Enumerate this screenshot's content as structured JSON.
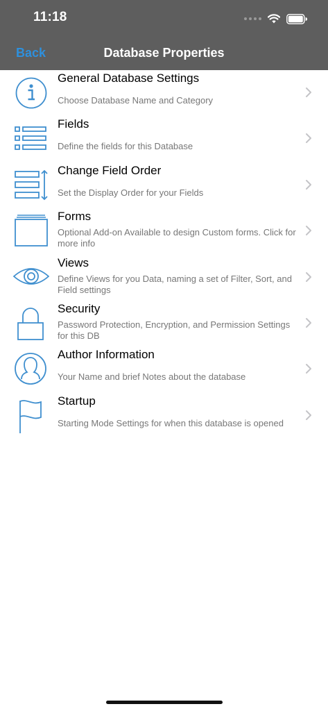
{
  "status": {
    "time": "11:18"
  },
  "nav": {
    "back_label": "Back",
    "title": "Database Properties"
  },
  "colors": {
    "accent": "#2e90dd",
    "header_bg": "#5e5e5e",
    "icon_blue": "#3f8fcf"
  },
  "items": [
    {
      "title": "General Database Settings",
      "subtitle": "Choose Database Name and Category",
      "icon": "info-icon"
    },
    {
      "title": "Fields",
      "subtitle": "Define the fields for this Database",
      "icon": "fields-list-icon"
    },
    {
      "title": "Change Field Order",
      "subtitle": "Set the Display Order for your Fields",
      "icon": "field-order-icon"
    },
    {
      "title": "Forms",
      "subtitle": "Optional Add-on Available to design Custom forms. Click for more info",
      "icon": "forms-icon"
    },
    {
      "title": "Views",
      "subtitle": "Define Views for you Data, naming a set of Filter, Sort, and Field settings",
      "icon": "eye-icon"
    },
    {
      "title": "Security",
      "subtitle": "Password Protection, Encryption, and Permission Settings for this DB",
      "icon": "lock-icon"
    },
    {
      "title": "Author Information",
      "subtitle": "Your Name and brief Notes about the database",
      "icon": "user-icon"
    },
    {
      "title": "Startup",
      "subtitle": "Starting Mode Settings for when this database is opened",
      "icon": "flag-icon"
    }
  ]
}
